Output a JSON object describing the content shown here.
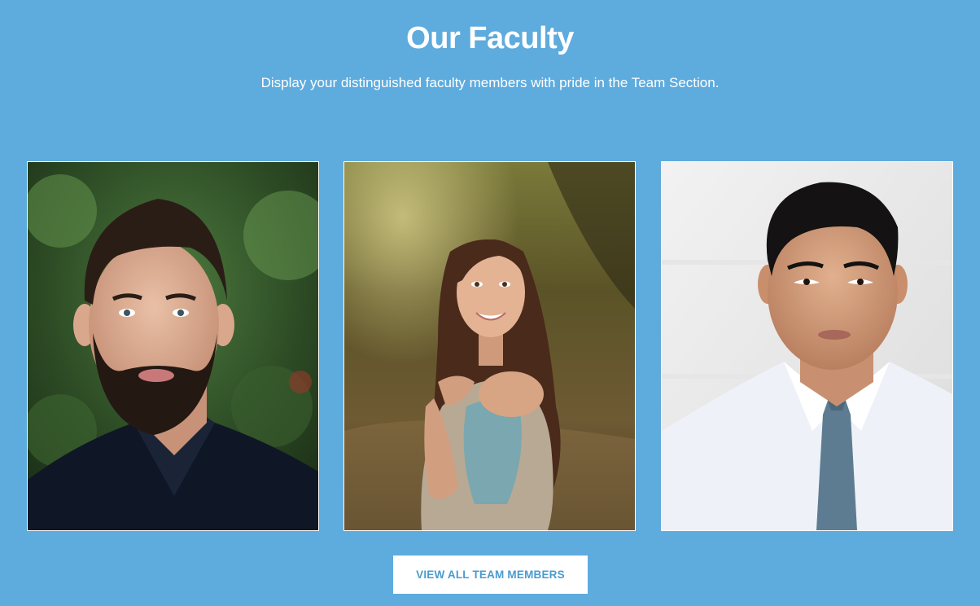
{
  "section": {
    "title": "Our Faculty",
    "subtitle": "Display your distinguished faculty members with pride in the Team Section."
  },
  "faculty": [
    {
      "photo": "bearded-man-portrait"
    },
    {
      "photo": "smiling-woman-portrait"
    },
    {
      "photo": "man-in-tie-portrait"
    }
  ],
  "cta": {
    "label": "VIEW ALL TEAM MEMBERS"
  },
  "colors": {
    "background": "#5eabdd",
    "button_bg": "#ffffff",
    "button_text": "#4a9bd0"
  }
}
